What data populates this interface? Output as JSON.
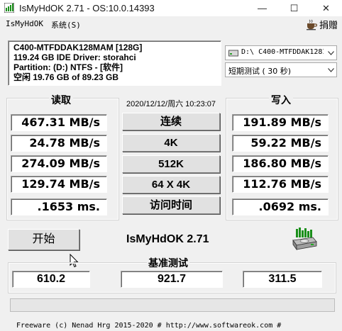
{
  "window": {
    "title": "IsMyHdOK 2.71 - OS:10.0.14393",
    "minimize_glyph": "—",
    "maximize_glyph": "☐",
    "close_glyph": "✕"
  },
  "menu": {
    "items": [
      "IsMyHdOK",
      "系统(S)"
    ],
    "donate_label": "捐赠"
  },
  "disk_info": {
    "model": "C400-MTFDDAK128MAM [128G]",
    "capacity_driver": "119.24 GB  IDE Driver: storahci",
    "partition": "Partition: (D:) NTFS - [软件]",
    "free": "空闲 19.76 GB of 89.23 GB"
  },
  "drive_select": {
    "value": "D:\\ C400-MTFDDAK128I"
  },
  "test_select": {
    "value": "短期测试 ( 30 秒)"
  },
  "read": {
    "label": "读取",
    "values": [
      "467.31 MB/s",
      "24.78 MB/s",
      "274.09 MB/s",
      "129.74 MB/s",
      ".1653 ms."
    ]
  },
  "write": {
    "label": "写入",
    "values": [
      "191.89 MB/s",
      "59.22 MB/s",
      "186.80 MB/s",
      "112.76 MB/s",
      ".0692 ms."
    ]
  },
  "datetime": "2020/12/12/周六 10:23:07",
  "tests": [
    "连续",
    "4K",
    "512K",
    "64 X 4K",
    "访问时间"
  ],
  "start_button": "开始",
  "program_name": "IsMyHdOK 2.71",
  "benchmark": {
    "label": "基准测试",
    "values": [
      "610.2",
      "921.7",
      "311.5"
    ]
  },
  "progress": 0,
  "footer": "Freeware (c) Nenad Hrg 2015-2020 # http://www.softwareok.com   #",
  "colors": {
    "accent_green": "#1a8f1a",
    "window_bg": "#f0f0f0"
  }
}
